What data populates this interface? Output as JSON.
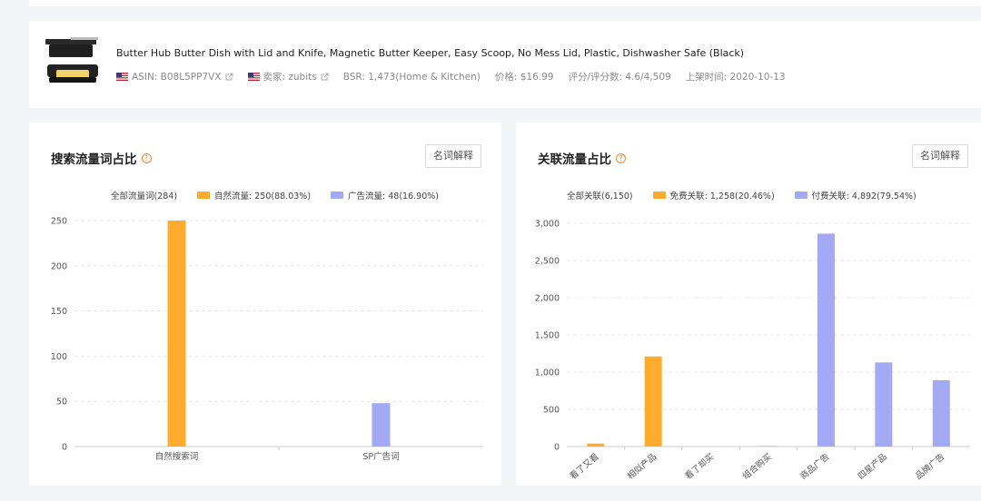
{
  "product": {
    "title": "Butter Hub Butter Dish with Lid and Knife, Magnetic Butter Keeper, Easy Scoop, No Mess Lid, Plastic, Dishwasher Safe (Black)",
    "asin": "ASIN: B08L5PP7VX",
    "seller": "卖家: zubits",
    "bsr": "BSR: 1,473(Home & Kitchen)",
    "price": "价格: $16.99",
    "rating": "评分/评分数: 4.6/4,509",
    "listed": "上架时间: 2020-10-13"
  },
  "left_card": {
    "title": "搜索流量词占比",
    "button": "名词解释",
    "legend_total": "全部流量词(284)",
    "legend_organic": "自然流量: 250(88.03%)",
    "legend_ad": "广告流量: 48(16.90%)"
  },
  "right_card": {
    "title": "关联流量占比",
    "button": "名词解释",
    "legend_total": "全部关联(6,150)",
    "legend_free": "免费关联: 1,258(20.46%)",
    "legend_paid": "付费关联: 4,892(79.54%)"
  },
  "colors": {
    "orange": "#ffab2e",
    "purple": "#a3a9f2",
    "help": "#f08a3c"
  },
  "chart_data": [
    {
      "type": "bar",
      "categories": [
        "自然搜索词",
        "SP广告词"
      ],
      "series": [
        {
          "name": "自然流量",
          "values": [
            250,
            0
          ]
        },
        {
          "name": "广告流量",
          "values": [
            0,
            48
          ]
        }
      ],
      "yticks": [
        "0",
        "50",
        "100",
        "150",
        "200",
        "250"
      ],
      "ylim": [
        0,
        250
      ],
      "grid": true
    },
    {
      "type": "bar",
      "categories": [
        "看了又看",
        "相似产品",
        "看了却买",
        "组合购买",
        "商品广告",
        "四星产品",
        "品牌广告"
      ],
      "series": [
        {
          "name": "免费关联",
          "values": [
            40,
            1210,
            0,
            8,
            0,
            0,
            0
          ]
        },
        {
          "name": "付费关联",
          "values": [
            0,
            0,
            0,
            0,
            2860,
            1130,
            890
          ]
        }
      ],
      "yticks": [
        "0",
        "500",
        "1,000",
        "1,500",
        "2,000",
        "2,500",
        "3,000"
      ],
      "ylim": [
        0,
        3000
      ],
      "grid": true
    }
  ]
}
